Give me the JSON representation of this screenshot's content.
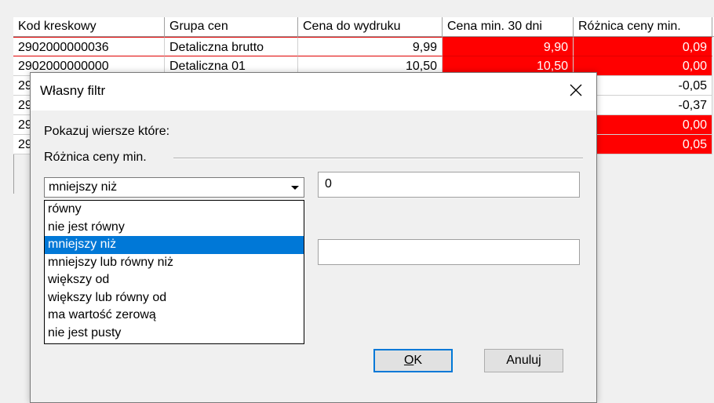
{
  "grid": {
    "columns": [
      "Kod kreskowy",
      "Grupa cen",
      "Cena do wydruku",
      "Cena min. 30 dni",
      "Różnica ceny min.",
      "("
    ],
    "rows": [
      {
        "barcode": "2902000000036",
        "group": "Detaliczna brutto",
        "price": "9,99",
        "min30": "9,90",
        "diff": "0,09",
        "red_min30": true,
        "red_diff": true
      },
      {
        "barcode": "2902000000000",
        "group": "Detaliczna 01",
        "price": "10,50",
        "min30": "10,50",
        "diff": "0,00",
        "red_min30": true,
        "red_diff": true
      },
      {
        "barcode": "29",
        "group": "",
        "price": "",
        "min30": "",
        "diff": "-0,05",
        "red_min30": false,
        "red_diff": false
      },
      {
        "barcode": "29",
        "group": "",
        "price": "",
        "min30": "",
        "diff": "-0,37",
        "red_min30": false,
        "red_diff": false
      },
      {
        "barcode": "29",
        "group": "",
        "price": "",
        "min30": "",
        "diff": "0,00",
        "red_min30": false,
        "red_diff": true
      },
      {
        "barcode": "29",
        "group": "",
        "price": "",
        "min30": "",
        "diff": "0,05",
        "red_min30": false,
        "red_diff": true
      }
    ]
  },
  "dialog": {
    "title": "Własny filtr",
    "prompt": "Pokazuj wiersze które:",
    "field_label": "Różnica ceny min.",
    "condition1_value": "mniejszy niż",
    "value1": "0",
    "value2": "",
    "options": [
      "równy",
      "nie jest równy",
      "mniejszy niż",
      "mniejszy lub równy niż",
      "większy od",
      "większy lub równy od",
      "ma wartość zerową",
      "nie jest pusty"
    ],
    "selected_option_index": 2,
    "ok_label": "OK",
    "cancel_label": "Anuluj"
  },
  "colors": {
    "highlight": "#ff0000",
    "selection": "#0078d7"
  }
}
